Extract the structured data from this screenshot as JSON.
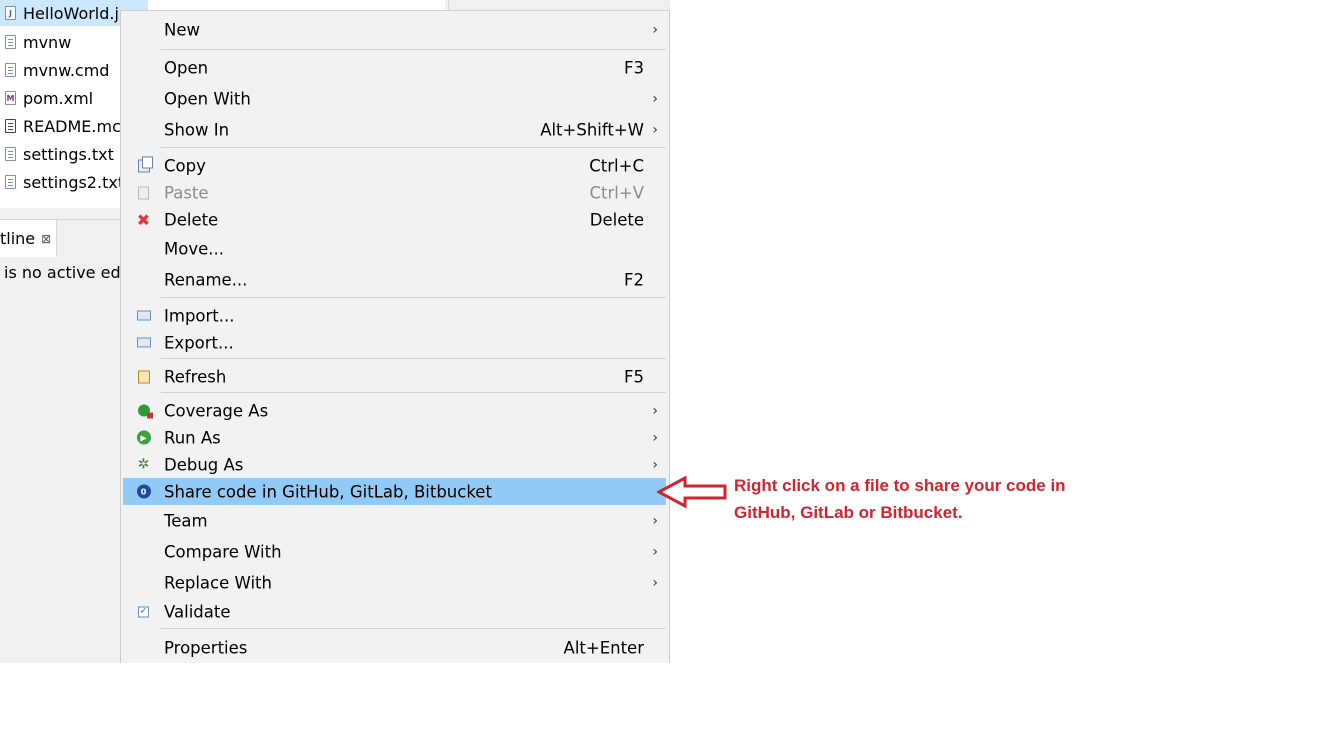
{
  "explorer": {
    "files": [
      {
        "name": "HelloWorld.j",
        "icon": "java-file-icon",
        "selected": true
      },
      {
        "name": "mvnw",
        "icon": "file-icon"
      },
      {
        "name": "mvnw.cmd",
        "icon": "file-icon"
      },
      {
        "name": "pom.xml",
        "icon": "maven-pom-icon"
      },
      {
        "name": "README.mc",
        "icon": "readme-file-icon"
      },
      {
        "name": "settings.txt",
        "icon": "file-icon"
      },
      {
        "name": "settings2.txt",
        "icon": "file-icon"
      }
    ]
  },
  "outline": {
    "tab_label": "tline",
    "close_glyph": "⊠",
    "message": "is no active edi"
  },
  "menu": {
    "items": [
      {
        "label": "New",
        "shortcut": "",
        "submenu": true
      },
      {
        "label": "Open",
        "shortcut": "F3"
      },
      {
        "label": "Open With",
        "shortcut": "",
        "submenu": true
      },
      {
        "label": "Show In",
        "shortcut": "Alt+Shift+W",
        "submenu": true
      },
      {
        "label": "Copy",
        "shortcut": "Ctrl+C",
        "icon": "copy-icon"
      },
      {
        "label": "Paste",
        "shortcut": "Ctrl+V",
        "icon": "paste-icon",
        "disabled": true
      },
      {
        "label": "Delete",
        "shortcut": "Delete",
        "icon": "delete-icon"
      },
      {
        "label": "Move...",
        "shortcut": ""
      },
      {
        "label": "Rename...",
        "shortcut": "F2"
      },
      {
        "label": "Import...",
        "shortcut": "",
        "icon": "import-icon"
      },
      {
        "label": "Export...",
        "shortcut": "",
        "icon": "export-icon"
      },
      {
        "label": "Refresh",
        "shortcut": "F5",
        "icon": "refresh-icon"
      },
      {
        "label": "Coverage As",
        "shortcut": "",
        "icon": "coverage-icon",
        "submenu": true
      },
      {
        "label": "Run As",
        "shortcut": "",
        "icon": "run-icon",
        "submenu": true
      },
      {
        "label": "Debug As",
        "shortcut": "",
        "icon": "debug-icon",
        "submenu": true
      },
      {
        "label": "Share code in GitHub, GitLab, Bitbucket",
        "shortcut": "",
        "icon": "share-code-icon",
        "highlighted": true
      },
      {
        "label": "Team",
        "shortcut": "",
        "submenu": true
      },
      {
        "label": "Compare With",
        "shortcut": "",
        "submenu": true
      },
      {
        "label": "Replace With",
        "shortcut": "",
        "submenu": true
      },
      {
        "label": "Validate",
        "shortcut": "",
        "icon": "validate-icon"
      },
      {
        "label": "Properties",
        "shortcut": "Alt+Enter"
      }
    ],
    "submenu_arrow": "›"
  },
  "annotation": {
    "line1": "Right click on a file to share your code in",
    "line2": "GitHub, GitLab or Bitbucket.",
    "color": "#d0242f"
  },
  "colors": {
    "highlight": "#91c9f7",
    "selection": "#cce8ff",
    "menu_bg": "#f2f2f2"
  }
}
